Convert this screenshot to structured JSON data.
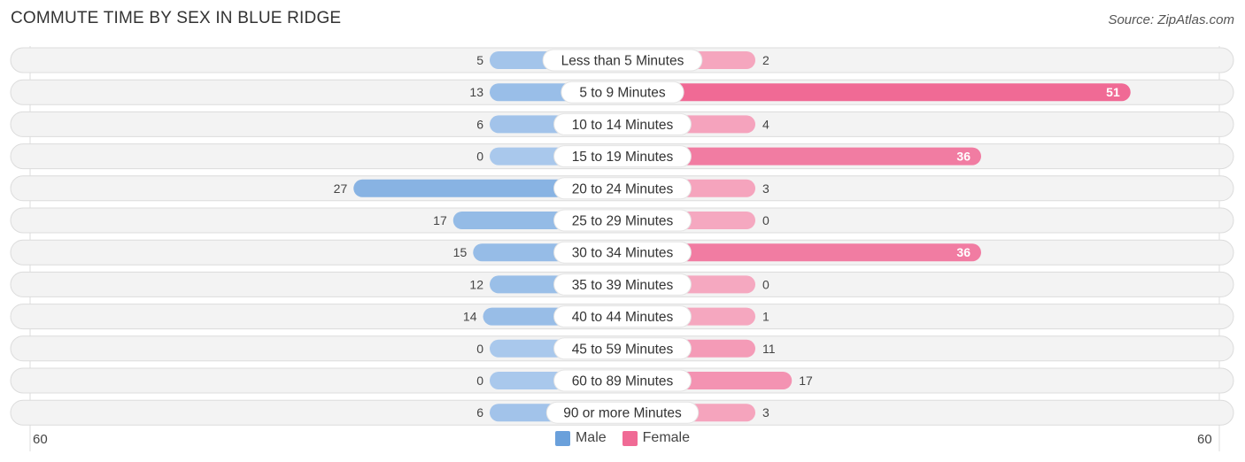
{
  "header": {
    "title": "COMMUTE TIME BY SEX IN BLUE RIDGE",
    "source": "Source: ZipAtlas.com"
  },
  "colors": {
    "male": "#6aa0db",
    "male_light": "#a9c8ec",
    "female": "#f06a95",
    "female_light": "#f5a8c0",
    "row_bg": "#f3f3f3"
  },
  "chart_data": {
    "type": "bar",
    "orientation": "horizontal-diverging",
    "title": "COMMUTE TIME BY SEX IN BLUE RIDGE",
    "categories": [
      "Less than 5 Minutes",
      "5 to 9 Minutes",
      "10 to 14 Minutes",
      "15 to 19 Minutes",
      "20 to 24 Minutes",
      "25 to 29 Minutes",
      "30 to 34 Minutes",
      "35 to 39 Minutes",
      "40 to 44 Minutes",
      "45 to 59 Minutes",
      "60 to 89 Minutes",
      "90 or more Minutes"
    ],
    "series": [
      {
        "name": "Male",
        "values": [
          5,
          13,
          6,
          0,
          27,
          17,
          15,
          12,
          14,
          0,
          0,
          6
        ]
      },
      {
        "name": "Female",
        "values": [
          2,
          51,
          4,
          36,
          3,
          0,
          36,
          0,
          1,
          11,
          17,
          3
        ]
      }
    ],
    "axis_min_label": "60",
    "axis_max_label": "60",
    "xlim": [
      -60,
      60
    ],
    "legend": {
      "position": "bottom-center",
      "entries": [
        "Male",
        "Female"
      ]
    }
  }
}
